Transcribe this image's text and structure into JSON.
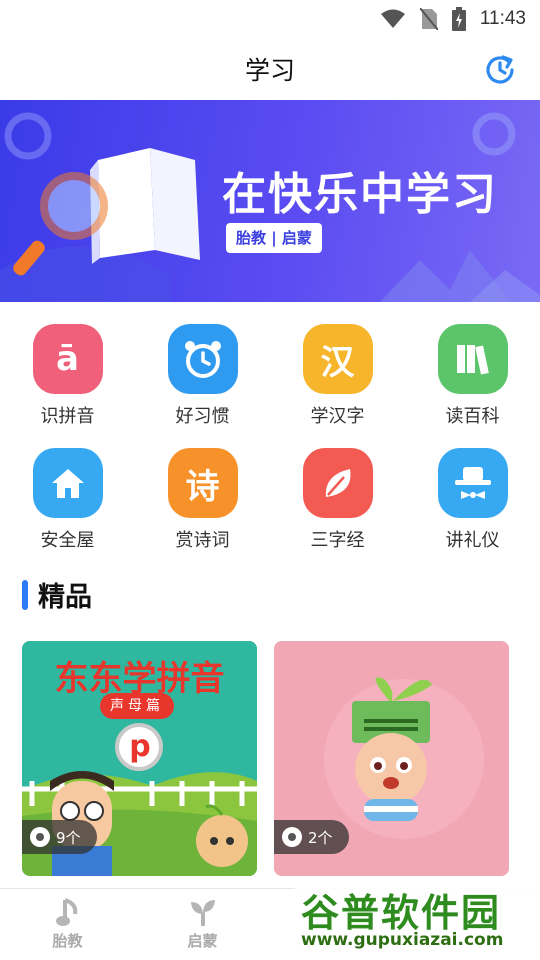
{
  "status_bar": {
    "time": "11:43"
  },
  "header": {
    "title": "学习",
    "history_icon": "history-clock-icon"
  },
  "banner": {
    "headline": "在快乐中学习",
    "tagline": "胎教 | 启蒙"
  },
  "grid": {
    "items": [
      {
        "label": "识拼音",
        "icon": "pinyin-icon",
        "glyph": "ā",
        "color": "#f0607a"
      },
      {
        "label": "好习惯",
        "icon": "alarm-clock-icon",
        "color": "#2f9bf0"
      },
      {
        "label": "学汉字",
        "icon": "hanzi-icon",
        "glyph": "汉",
        "color": "#f7b52c"
      },
      {
        "label": "读百科",
        "icon": "books-icon",
        "color": "#5cc46a"
      },
      {
        "label": "安全屋",
        "icon": "house-icon",
        "color": "#37a8f2"
      },
      {
        "label": "赏诗词",
        "icon": "poem-icon",
        "glyph": "诗",
        "color": "#f7922a"
      },
      {
        "label": "三字经",
        "icon": "leaf-icon",
        "color": "#f25a52"
      },
      {
        "label": "讲礼仪",
        "icon": "gentleman-icon",
        "color": "#37a8f2"
      }
    ]
  },
  "section": {
    "title": "精品"
  },
  "cards": [
    {
      "title": "东东学拼音",
      "subtitle": "声母篇",
      "badge_letter": "p",
      "count": "9个"
    },
    {
      "count": "2个"
    }
  ],
  "bottom_nav": {
    "items": [
      {
        "label": "胎教",
        "icon": "music-note-icon"
      },
      {
        "label": "启蒙",
        "icon": "sprout-icon"
      }
    ]
  },
  "watermark": {
    "name": "谷普软件园",
    "url": "www.gupuxiazai.com"
  }
}
